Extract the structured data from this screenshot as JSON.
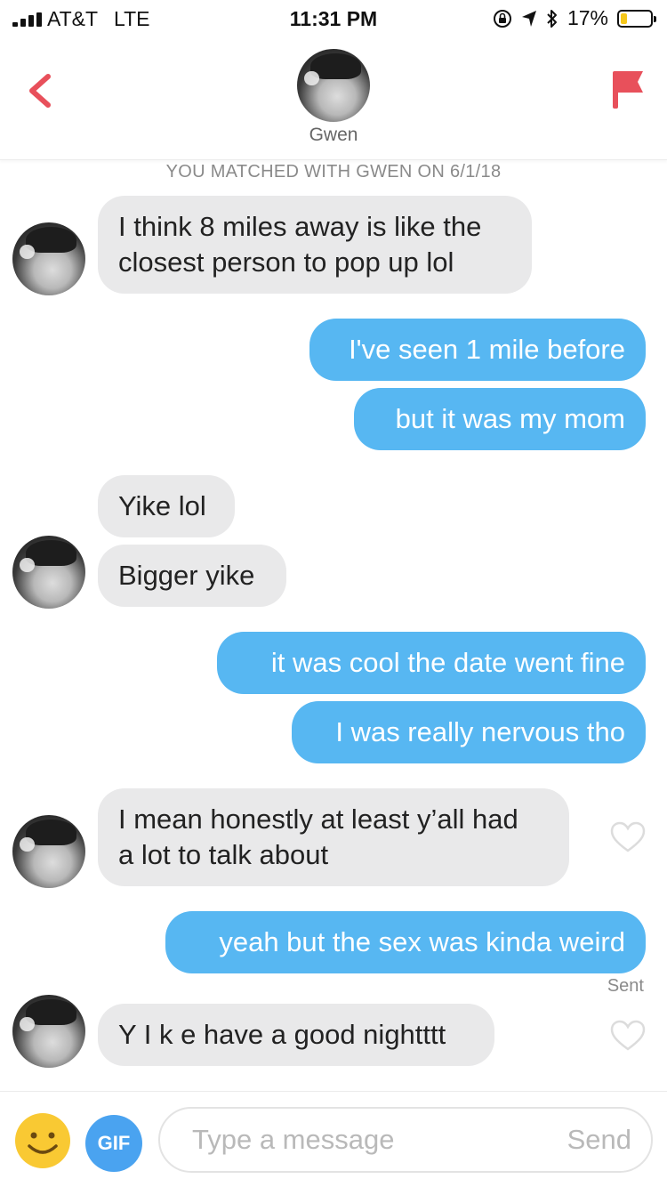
{
  "status_bar": {
    "carrier": "AT&T",
    "network": "LTE",
    "time": "11:31 PM",
    "battery_percent": "17%",
    "battery_level": 0.17,
    "icons": [
      "signal-icon",
      "lock-rotation-icon",
      "location-icon",
      "bluetooth-icon",
      "battery-icon"
    ]
  },
  "header": {
    "back_icon": "chevron-left-icon",
    "report_icon": "flag-icon",
    "name": "Gwen",
    "accent_color": "#e8505b"
  },
  "match_banner": "YOU MATCHED WITH GWEN ON 6/1/18",
  "messages": [
    {
      "from": "them",
      "lines": [
        "I think 8 miles away is like the",
        "closest person to pop up lol"
      ]
    },
    {
      "from": "me",
      "text": "I've seen 1 mile before"
    },
    {
      "from": "me",
      "text": "but it was my mom"
    },
    {
      "from": "them",
      "text": "Yike lol"
    },
    {
      "from": "them",
      "text": "Bigger yike"
    },
    {
      "from": "me",
      "text": "it was cool the date went fine"
    },
    {
      "from": "me",
      "text": "I was really nervous tho"
    },
    {
      "from": "them",
      "lines": [
        "I mean honestly at least y’all had",
        "a lot to talk about"
      ]
    },
    {
      "from": "me",
      "text": "yeah but the sex was kinda weird"
    },
    {
      "from": "them",
      "text": "Y I k e have a good nightttt"
    }
  ],
  "sent_label": "Sent",
  "composer": {
    "emoji_icon": "smiley-icon",
    "gif_label": "GIF",
    "placeholder": "Type a message",
    "send_label": "Send"
  },
  "colors": {
    "outgoing_bubble": "#57b7f2",
    "incoming_bubble": "#e9e9ea",
    "accent": "#e8505b",
    "gif_button": "#4aa3f0",
    "emoji": "#f9c933"
  }
}
